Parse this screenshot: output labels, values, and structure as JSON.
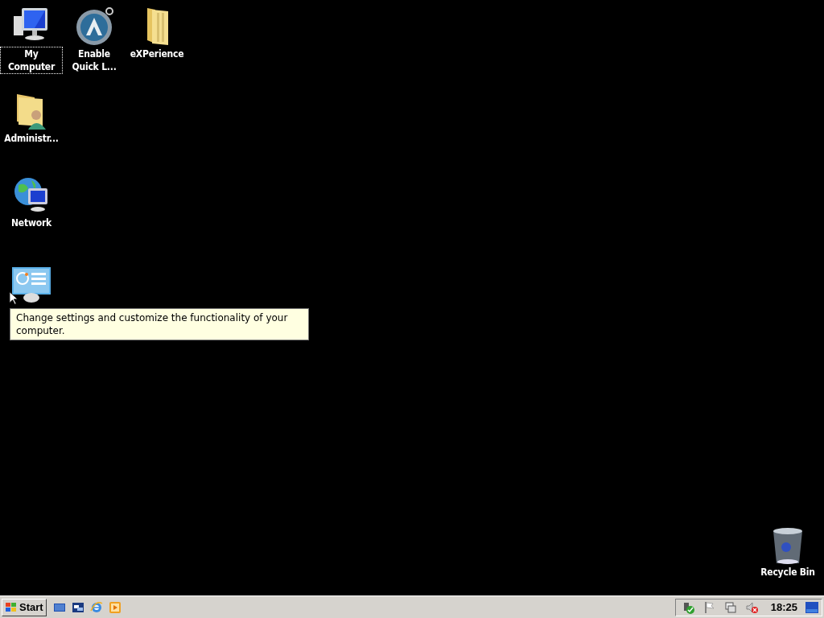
{
  "desktop": {
    "icon_columns": [
      [
        {
          "kind": "computer",
          "label": "My Computer",
          "selected": true
        },
        {
          "kind": "user-folder",
          "label": "Administr...",
          "selected": false
        },
        {
          "kind": "network",
          "label": "Network",
          "selected": false
        },
        {
          "kind": "control-panel"
        }
      ],
      [
        {
          "kind": "launcher",
          "label": "Enable Quick L...",
          "selected": false
        }
      ],
      [
        {
          "kind": "folder",
          "label": "eXPerience",
          "selected": false
        }
      ]
    ],
    "recycle_bin": {
      "label": "Recycle Bin"
    },
    "tooltip": {
      "text": "Change settings and customize the functionality of your computer."
    }
  },
  "taskbar": {
    "start_button": "Start",
    "quick_launch": [
      {
        "kind": "desktop"
      },
      {
        "kind": "window"
      },
      {
        "kind": "browser"
      },
      {
        "kind": "media"
      }
    ],
    "tray_icons": [
      {
        "kind": "safety"
      },
      {
        "kind": "flag"
      },
      {
        "kind": "network"
      },
      {
        "kind": "volume"
      }
    ],
    "clock": "18:25"
  }
}
